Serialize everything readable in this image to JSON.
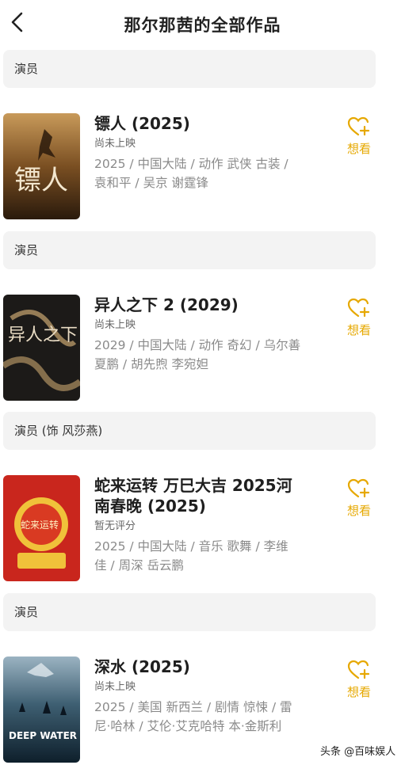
{
  "header": {
    "title": "那尔那茜的全部作品"
  },
  "icons": {
    "back": "back-arrow-icon",
    "want": "heart-plus-icon"
  },
  "colors": {
    "accent": "#e6a800",
    "bar_bg": "#f3f3f3",
    "meta": "#8a8a8a"
  },
  "works": [
    {
      "role": "演员",
      "title": "镖人 (2025)",
      "status": "尚未上映",
      "meta_line1": "2025 / 中国大陆 / 动作 武侠 古装 /",
      "meta_line2": "袁和平 / 吴京 谢霆锋",
      "want_label": "想看",
      "poster_text": "镖人"
    },
    {
      "role": "演员",
      "title": "异人之下 2 (2029)",
      "status": "尚未上映",
      "meta_line1": "2029 / 中国大陆 / 动作 奇幻 / 乌尔善",
      "meta_line2": "夏鹏 / 胡先煦 李宛妲",
      "want_label": "想看",
      "poster_text": "异人之下"
    },
    {
      "role": "演员 (饰 风莎燕)",
      "title_line1": "蛇来运转 万巳大吉 2025河",
      "title_line2": "南春晚 (2025)",
      "status": "暂无评分",
      "meta_line1": "2025 / 中国大陆 / 音乐 歌舞 / 李维",
      "meta_line2": "佳 / 周深 岳云鹏",
      "want_label": "想看",
      "poster_text": "蛇来运转"
    },
    {
      "role": "演员",
      "title": "深水 (2025)",
      "status": "尚未上映",
      "meta_line1": "2025 / 美国 新西兰 / 剧情 惊悚 / 雷",
      "meta_line2": "尼·哈林 / 艾伦·艾克哈特 本·金斯利",
      "want_label": "想看",
      "poster_text": "DEEP WATER"
    }
  ],
  "watermark": "头条 @百味娱人"
}
